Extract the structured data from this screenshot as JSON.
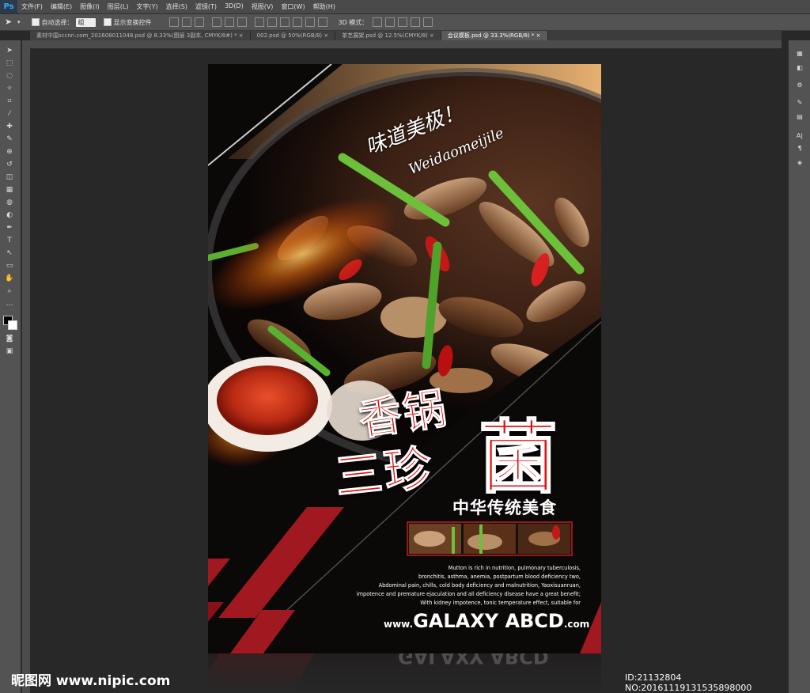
{
  "app": {
    "logo": "Ps"
  },
  "menu": [
    "文件(F)",
    "编辑(E)",
    "图像(I)",
    "图层(L)",
    "文字(Y)",
    "选择(S)",
    "滤镜(T)",
    "3D(D)",
    "视图(V)",
    "窗口(W)",
    "帮助(H)"
  ],
  "options": {
    "auto_select_label": "自动选择：",
    "auto_select_value": "组",
    "show_transform_label": "显示变换控件",
    "mode_3d_label": "3D 模式："
  },
  "tabs": [
    "素材中国sccnn.com_201608011048.psd @ 8.33%(图层 3副本, CMYK/8#) *",
    "002.psd @ 50%(RGB/8)",
    "茶艺展架.psd @ 12.5%(CMYK/8)",
    "会议模板.psd @ 33.3%(RGB/8) *"
  ],
  "active_tab_index": 3,
  "poster": {
    "script_line1": "味道美极！",
    "script_line2": "Weidaomeijile",
    "title_part1": "香锅",
    "title_part2": "三珍",
    "title_part3": "菌",
    "subtitle": "中华传统美食",
    "body_lines": [
      "Mutton is rich in nutrition, pulmonary tuberculosis,",
      "bronchitis, asthma, anemia, postpartum blood deficiency two,",
      "Abdominal pain, chills, cold body deficiency and malnutrition, Yaoxisuanruan,",
      "impotence and premature ejaculation and all deficiency disease have a great benefit;",
      "With kidney impotence, tonic temperature effect, suitable for"
    ],
    "url_prefix": "www.",
    "url_main": "GALAXY ABCD",
    "url_suffix": ".com"
  },
  "watermark": {
    "left": "昵图网 www.nipic.com",
    "right": "ID:21132804 NO:20161119131535898000"
  },
  "colors": {
    "title_red": "#e01010",
    "accent_red": "#a01820",
    "ps_blue": "#31a8ff"
  }
}
